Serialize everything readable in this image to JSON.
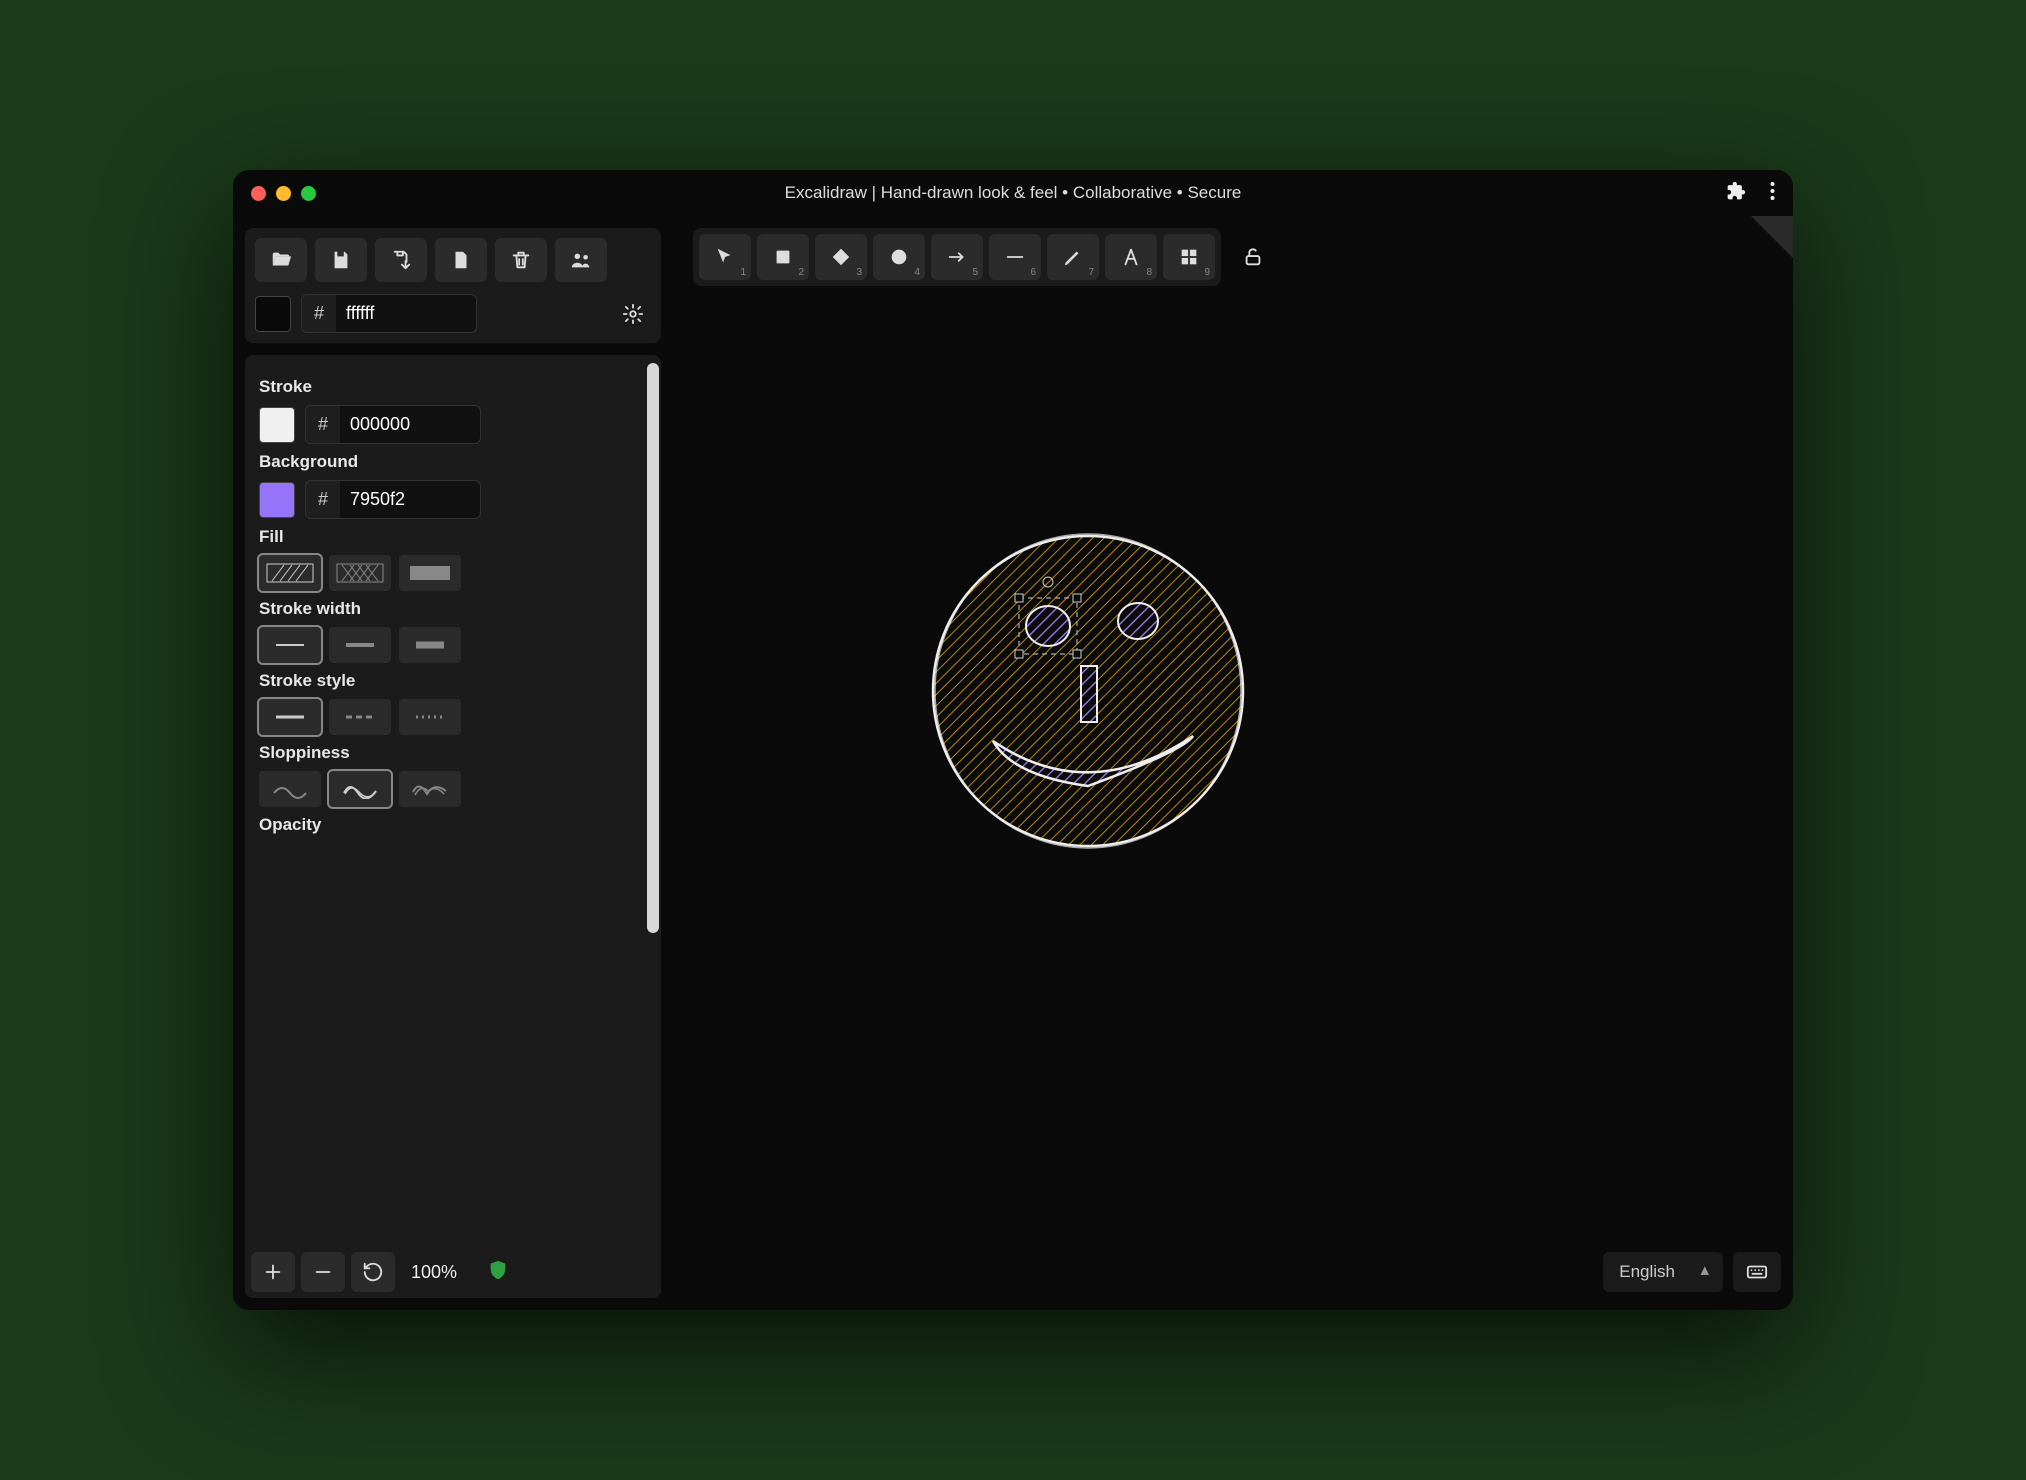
{
  "window": {
    "title": "Excalidraw | Hand-drawn look & feel • Collaborative • Secure"
  },
  "toolbar_file": {
    "open": "Open",
    "save": "Save",
    "clear_clipboard": "Copy to clipboard",
    "export": "Export",
    "delete": "Delete",
    "collaborate": "Live collaboration"
  },
  "canvas_color": {
    "hash": "#",
    "value": "ffffff"
  },
  "props": {
    "stroke_label": "Stroke",
    "stroke_hash": "#",
    "stroke_value": "000000",
    "stroke_swatch": "#f0f0f0",
    "background_label": "Background",
    "background_hash": "#",
    "background_value": "7950f2",
    "background_swatch": "#9775fa",
    "fill_label": "Fill",
    "stroke_width_label": "Stroke width",
    "stroke_style_label": "Stroke style",
    "sloppiness_label": "Sloppiness",
    "opacity_label": "Opacity"
  },
  "tools": [
    {
      "name": "selection",
      "num": "1"
    },
    {
      "name": "rectangle",
      "num": "2"
    },
    {
      "name": "diamond",
      "num": "3"
    },
    {
      "name": "ellipse",
      "num": "4"
    },
    {
      "name": "arrow",
      "num": "5"
    },
    {
      "name": "line",
      "num": "6"
    },
    {
      "name": "draw",
      "num": "7"
    },
    {
      "name": "text",
      "num": "8"
    },
    {
      "name": "library",
      "num": "9"
    }
  ],
  "zoom": {
    "value": "100%"
  },
  "language": {
    "selected": "English"
  }
}
